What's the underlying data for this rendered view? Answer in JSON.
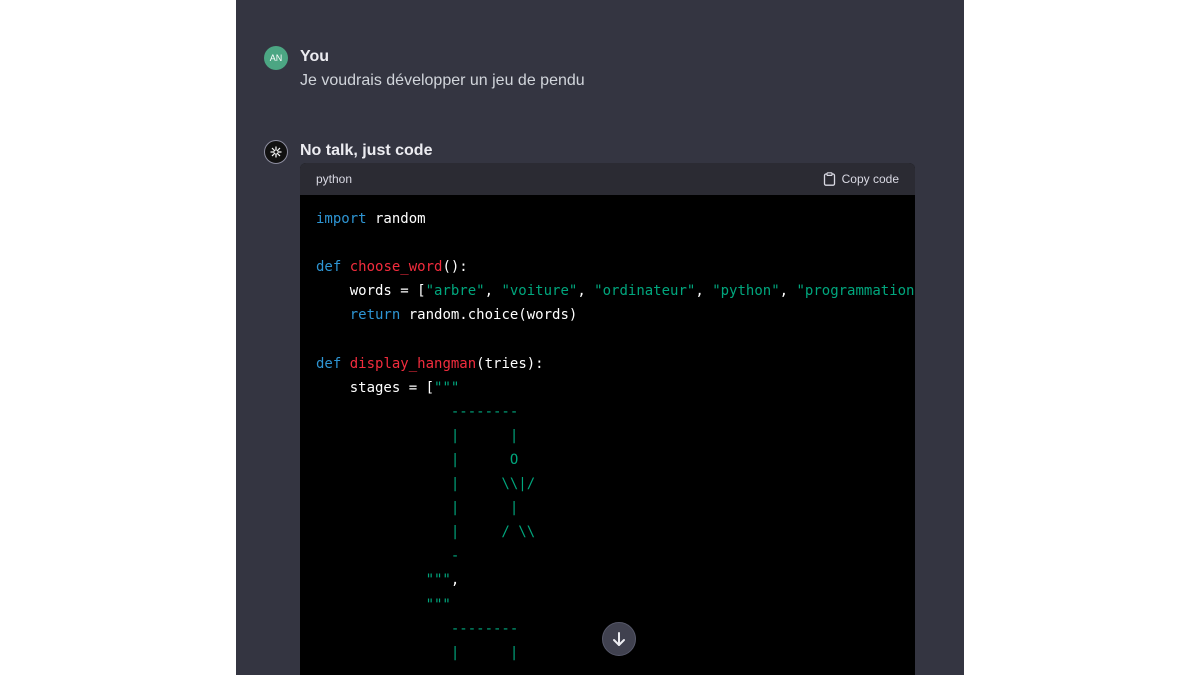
{
  "user_message": {
    "avatar_initials": "AN",
    "author": "You",
    "text": "Je voudrais développer un jeu de pendu"
  },
  "bot_message": {
    "author": "No talk, just code",
    "code_block": {
      "language": "python",
      "copy_label": "Copy code",
      "lines": [
        [
          {
            "t": "import",
            "c": "kw"
          },
          {
            "t": " random"
          }
        ],
        [],
        [
          {
            "t": "def",
            "c": "kw"
          },
          {
            "t": " "
          },
          {
            "t": "choose_word",
            "c": "fn"
          },
          {
            "t": "():"
          }
        ],
        [
          {
            "t": "    words = ["
          },
          {
            "t": "\"arbre\"",
            "c": "str"
          },
          {
            "t": ", "
          },
          {
            "t": "\"voiture\"",
            "c": "str"
          },
          {
            "t": ", "
          },
          {
            "t": "\"ordinateur\"",
            "c": "str"
          },
          {
            "t": ", "
          },
          {
            "t": "\"python\"",
            "c": "str"
          },
          {
            "t": ", "
          },
          {
            "t": "\"programmation",
            "c": "str"
          }
        ],
        [
          {
            "t": "    "
          },
          {
            "t": "return",
            "c": "kw"
          },
          {
            "t": " random.choice(words)"
          }
        ],
        [],
        [
          {
            "t": "def",
            "c": "kw"
          },
          {
            "t": " "
          },
          {
            "t": "display_hangman",
            "c": "fn"
          },
          {
            "t": "(tries):"
          }
        ],
        [
          {
            "t": "    stages = ["
          },
          {
            "t": "\"\"\"",
            "c": "str"
          }
        ],
        [
          {
            "t": "                --------",
            "c": "str"
          }
        ],
        [
          {
            "t": "                |      |",
            "c": "str"
          }
        ],
        [
          {
            "t": "                |      O",
            "c": "str"
          }
        ],
        [
          {
            "t": "                |     \\\\|/",
            "c": "str"
          }
        ],
        [
          {
            "t": "                |      |",
            "c": "str"
          }
        ],
        [
          {
            "t": "                |     / \\\\",
            "c": "str"
          }
        ],
        [
          {
            "t": "                -",
            "c": "str"
          }
        ],
        [
          {
            "t": "             \"\"\"",
            "c": "str"
          },
          {
            "t": ","
          }
        ],
        [
          {
            "t": "             \"\"\"",
            "c": "str"
          }
        ],
        [
          {
            "t": "                --------",
            "c": "str"
          }
        ],
        [
          {
            "t": "                |      |",
            "c": "str"
          }
        ]
      ]
    }
  },
  "colors": {
    "background": "#343541",
    "keyword": "#2e95d3",
    "function": "#f22c3d",
    "string": "#00a67d",
    "user_avatar": "#4ca683"
  },
  "icons": [
    "clipboard-icon",
    "openai-logo-icon",
    "arrow-down-icon"
  ]
}
